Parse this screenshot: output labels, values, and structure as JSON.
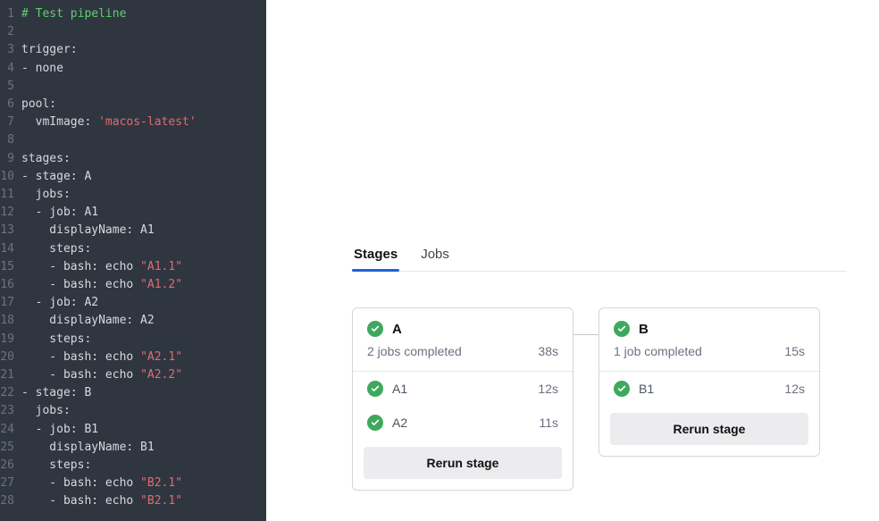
{
  "editor": {
    "lines": [
      {
        "n": 1,
        "segments": [
          {
            "cls": "comment",
            "text": "# Test pipeline"
          }
        ]
      },
      {
        "n": 2,
        "segments": [
          {
            "cls": "",
            "text": ""
          }
        ]
      },
      {
        "n": 3,
        "segments": [
          {
            "cls": "",
            "text": "trigger:"
          }
        ]
      },
      {
        "n": 4,
        "segments": [
          {
            "cls": "",
            "text": "- none"
          }
        ]
      },
      {
        "n": 5,
        "segments": [
          {
            "cls": "",
            "text": ""
          }
        ]
      },
      {
        "n": 6,
        "segments": [
          {
            "cls": "",
            "text": "pool:"
          }
        ]
      },
      {
        "n": 7,
        "segments": [
          {
            "cls": "",
            "text": "  vmImage: "
          },
          {
            "cls": "str",
            "text": "'macos-latest'"
          }
        ]
      },
      {
        "n": 8,
        "segments": [
          {
            "cls": "",
            "text": ""
          }
        ]
      },
      {
        "n": 9,
        "segments": [
          {
            "cls": "",
            "text": "stages:"
          }
        ]
      },
      {
        "n": 10,
        "segments": [
          {
            "cls": "",
            "text": "- stage: A"
          }
        ]
      },
      {
        "n": 11,
        "segments": [
          {
            "cls": "",
            "text": "  jobs:"
          }
        ]
      },
      {
        "n": 12,
        "segments": [
          {
            "cls": "",
            "text": "  - job: A1"
          }
        ]
      },
      {
        "n": 13,
        "segments": [
          {
            "cls": "",
            "text": "    displayName: A1"
          }
        ]
      },
      {
        "n": 14,
        "segments": [
          {
            "cls": "",
            "text": "    steps:"
          }
        ]
      },
      {
        "n": 15,
        "segments": [
          {
            "cls": "",
            "text": "    - bash: echo "
          },
          {
            "cls": "str",
            "text": "\"A1.1\""
          }
        ]
      },
      {
        "n": 16,
        "segments": [
          {
            "cls": "",
            "text": "    - bash: echo "
          },
          {
            "cls": "str",
            "text": "\"A1.2\""
          }
        ]
      },
      {
        "n": 17,
        "segments": [
          {
            "cls": "",
            "text": "  - job: A2"
          }
        ]
      },
      {
        "n": 18,
        "segments": [
          {
            "cls": "",
            "text": "    displayName: A2"
          }
        ]
      },
      {
        "n": 19,
        "segments": [
          {
            "cls": "",
            "text": "    steps:"
          }
        ]
      },
      {
        "n": 20,
        "segments": [
          {
            "cls": "",
            "text": "    - bash: echo "
          },
          {
            "cls": "str",
            "text": "\"A2.1\""
          }
        ]
      },
      {
        "n": 21,
        "segments": [
          {
            "cls": "",
            "text": "    - bash: echo "
          },
          {
            "cls": "str",
            "text": "\"A2.2\""
          }
        ]
      },
      {
        "n": 22,
        "segments": [
          {
            "cls": "",
            "text": "- stage: B"
          }
        ]
      },
      {
        "n": 23,
        "segments": [
          {
            "cls": "",
            "text": "  jobs:"
          }
        ]
      },
      {
        "n": 24,
        "segments": [
          {
            "cls": "",
            "text": "  - job: B1"
          }
        ]
      },
      {
        "n": 25,
        "segments": [
          {
            "cls": "",
            "text": "    displayName: B1"
          }
        ]
      },
      {
        "n": 26,
        "segments": [
          {
            "cls": "",
            "text": "    steps:"
          }
        ]
      },
      {
        "n": 27,
        "segments": [
          {
            "cls": "",
            "text": "    - bash: echo "
          },
          {
            "cls": "str",
            "text": "\"B2.1\""
          }
        ]
      },
      {
        "n": 28,
        "segments": [
          {
            "cls": "",
            "text": "    - bash: echo "
          },
          {
            "cls": "str",
            "text": "\"B2.1\""
          }
        ]
      }
    ]
  },
  "panel": {
    "tabs": [
      {
        "label": "Stages",
        "active": true
      },
      {
        "label": "Jobs",
        "active": false
      }
    ],
    "stages": [
      {
        "name": "A",
        "status": "success",
        "summary": "2 jobs completed",
        "duration": "38s",
        "jobs": [
          {
            "name": "A1",
            "status": "success",
            "duration": "12s"
          },
          {
            "name": "A2",
            "status": "success",
            "duration": "11s"
          }
        ],
        "rerun_label": "Rerun stage"
      },
      {
        "name": "B",
        "status": "success",
        "summary": "1 job completed",
        "duration": "15s",
        "jobs": [
          {
            "name": "B1",
            "status": "success",
            "duration": "12s"
          }
        ],
        "rerun_label": "Rerun stage"
      }
    ]
  }
}
